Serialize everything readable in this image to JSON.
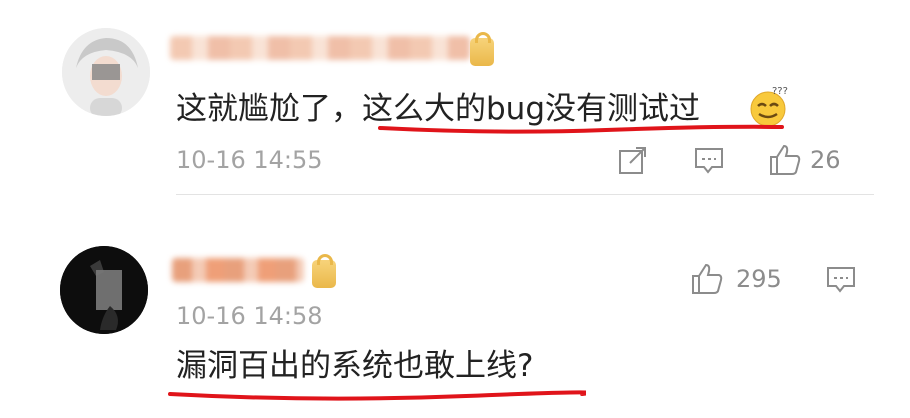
{
  "comments": [
    {
      "prefix": "这就尴尬了，",
      "highlight": "这么大的bug没有测试过",
      "time": "10-16 14:55",
      "likes": "26",
      "emoji": "dizzy-face-emoji",
      "underline_color": "#e0141a"
    },
    {
      "text": "漏洞百出的系统也敢上线?",
      "time": "10-16 14:58",
      "likes": "295",
      "underline_color": "#e0141a"
    }
  ],
  "icons": {
    "share": "share-icon",
    "reply": "comment-icon",
    "like": "thumbs-up-icon",
    "badge": "member-badge-icon"
  },
  "colors": {
    "text": "#222222",
    "meta": "#a3a3a3",
    "icon": "#8c8c8c",
    "annotation": "#e0141a"
  }
}
